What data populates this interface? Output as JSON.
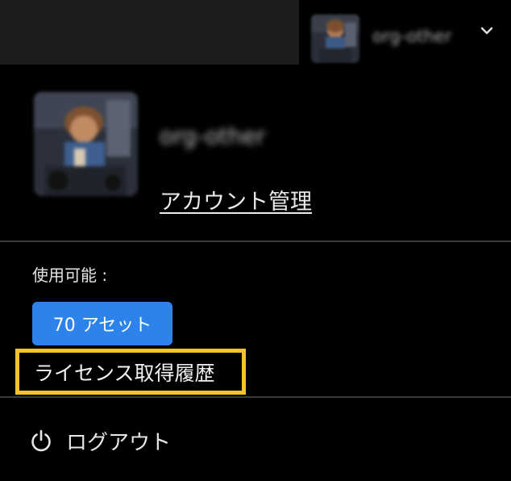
{
  "header": {
    "org_name": "org-other",
    "dropdown_icon": "chevron-down-icon"
  },
  "profile": {
    "org_name": "org-other",
    "account_link": "アカウント管理"
  },
  "availability": {
    "label": "使用可能 :",
    "assets_button": "70 アセット"
  },
  "license_history": {
    "label": "ライセンス取得履歴",
    "highlight_color": "#f6c22c"
  },
  "logout": {
    "label": "ログアウト",
    "icon": "power-icon"
  },
  "colors": {
    "background": "#000000",
    "topbar": "#1d1d1d",
    "accent_button": "#2d83e9",
    "divider": "#3a3a3a"
  }
}
